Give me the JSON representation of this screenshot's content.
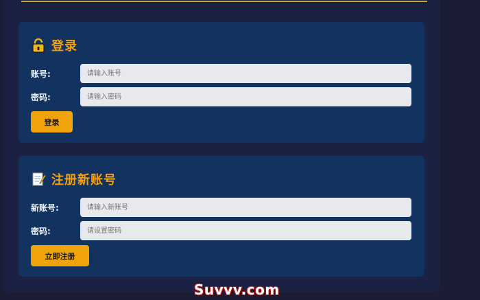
{
  "login": {
    "title": "登录",
    "title_icon": "lock-icon",
    "username_label": "账号:",
    "username_placeholder": "请输入账号",
    "password_label": "密码:",
    "password_placeholder": "请输入密码",
    "submit_label": "登录"
  },
  "register": {
    "title": "注册新账号",
    "title_icon": "memo-icon",
    "username_label": "新账号:",
    "username_placeholder": "请输入新账号",
    "password_label": "密码:",
    "password_placeholder": "请设置密码",
    "submit_label": "立即注册"
  },
  "watermark": "Suvvv.com",
  "colors": {
    "accent": "#f0a30a",
    "card_bg": "#12325f",
    "page_bg": "#1a1d33",
    "panel_bg": "#1b2142"
  }
}
